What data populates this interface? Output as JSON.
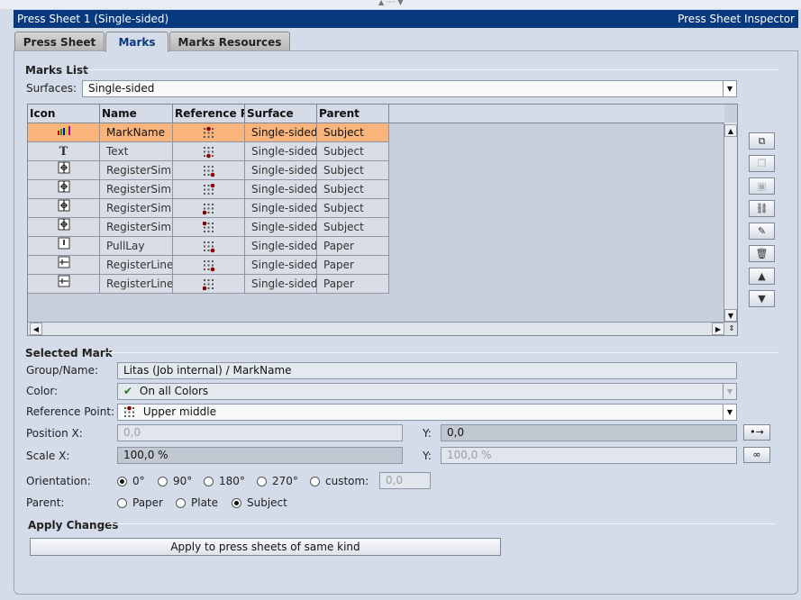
{
  "window": {
    "title_left": "Press Sheet 1 (Single-sided)",
    "title_right": "Press Sheet Inspector"
  },
  "tabs": [
    {
      "label": "Press Sheet",
      "active": false
    },
    {
      "label": "Marks",
      "active": true
    },
    {
      "label": "Marks Resources",
      "active": false
    }
  ],
  "marks_list": {
    "heading": "Marks List",
    "surfaces_label": "Surfaces:",
    "surfaces_value": "Single-sided",
    "columns": [
      "Icon",
      "Name",
      "Reference Po",
      "Surface",
      "Parent"
    ],
    "rows": [
      {
        "icon": "color-bar-icon",
        "name": "MarkName",
        "ref": "upper-middle",
        "surface": "Single-sided",
        "parent": "Subject",
        "selected": true
      },
      {
        "icon": "text-icon",
        "name": "Text",
        "ref": "lower-middle",
        "surface": "Single-sided",
        "parent": "Subject",
        "selected": false
      },
      {
        "icon": "register-simple-icon",
        "name": "RegisterSimp",
        "ref": "lower-right",
        "surface": "Single-sided",
        "parent": "Subject",
        "selected": false
      },
      {
        "icon": "register-simple-icon",
        "name": "RegisterSimp",
        "ref": "upper-right",
        "surface": "Single-sided",
        "parent": "Subject",
        "selected": false
      },
      {
        "icon": "register-simple-icon",
        "name": "RegisterSimp",
        "ref": "lower-left",
        "surface": "Single-sided",
        "parent": "Subject",
        "selected": false
      },
      {
        "icon": "register-simple-icon",
        "name": "RegisterSimp",
        "ref": "upper-left",
        "surface": "Single-sided",
        "parent": "Subject",
        "selected": false
      },
      {
        "icon": "pull-lay-icon",
        "name": "PullLay",
        "ref": "lower-right",
        "surface": "Single-sided",
        "parent": "Paper",
        "selected": false
      },
      {
        "icon": "register-line-icon",
        "name": "RegisterLine",
        "ref": "lower-right",
        "surface": "Single-sided",
        "parent": "Paper",
        "selected": false
      },
      {
        "icon": "register-line-icon",
        "name": "RegisterLine",
        "ref": "lower-left",
        "surface": "Single-sided",
        "parent": "Paper",
        "selected": false
      }
    ]
  },
  "selected_mark": {
    "heading": "Selected Mark",
    "group_name_label": "Group/Name:",
    "group_name_value": "Litas (Job internal) / MarkName",
    "color_label": "Color:",
    "color_value": "On all Colors",
    "ref_point_label": "Reference Point:",
    "ref_point_value": "Upper middle",
    "pos_x_label": "Position X:",
    "pos_x_value": "0,0",
    "pos_y_label": "Y:",
    "pos_y_value": "0,0",
    "scale_x_label": "Scale X:",
    "scale_x_value": "100,0 %",
    "scale_y_label": "Y:",
    "scale_y_value": "100,0 %",
    "orientation_label": "Orientation:",
    "orientation_options": [
      "0°",
      "90°",
      "180°",
      "270°",
      "custom:"
    ],
    "orientation_selected": 0,
    "orientation_custom_value": "0,0",
    "parent_label": "Parent:",
    "parent_options": [
      "Paper",
      "Plate",
      "Subject"
    ],
    "parent_selected": 2
  },
  "apply_changes": {
    "heading": "Apply Changes",
    "button_label": "Apply to press sheets of same kind"
  },
  "colors": {
    "title_bar": "#06397e",
    "selection": "#f8b47b",
    "panel": "#d4dbe9",
    "reference_dot": "#8b0000"
  }
}
